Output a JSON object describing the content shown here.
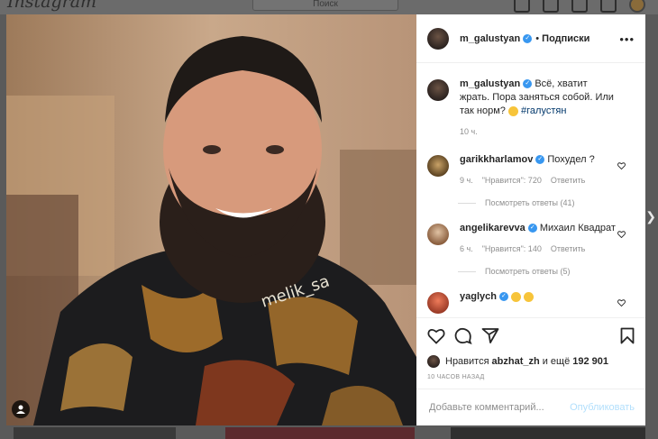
{
  "app": {
    "logo": "Instagram",
    "search_placeholder": "Поиск"
  },
  "post": {
    "author": "m_galustyan",
    "follow_separator": "•",
    "follow_label": "Подписки",
    "more_label": "•••",
    "photo_overlay_text": "melik_sa",
    "caption": {
      "username": "m_galustyan",
      "text": "Всё, хватит жрать. Пора заняться собой. Или так норм?",
      "hashtag": "#галустян",
      "time": "10 ч."
    },
    "comments": [
      {
        "username": "garikkharlamov",
        "text": "Похудел ?",
        "time": "9 ч.",
        "likes": "\"Нравится\": 720",
        "reply": "Ответить",
        "view_replies": "Посмотреть ответы (41)"
      },
      {
        "username": "angelikarevva",
        "text": "Михаил Квадрат",
        "time": "6 ч.",
        "likes": "\"Нравится\": 140",
        "reply": "Ответить",
        "view_replies": "Посмотреть ответы (5)"
      },
      {
        "username": "yaglych",
        "text": ""
      }
    ],
    "likes": {
      "prefix": "Нравится",
      "user": "abzhat_zh",
      "suffix": "и ещё",
      "count": "192 901"
    },
    "timestamp": "10 ЧАСОВ НАЗАД",
    "composer": {
      "placeholder": "Добавьте комментарий...",
      "publish": "Опубликовать"
    }
  },
  "colors": {
    "verified": "#3897f0",
    "link": "#00376b",
    "publish_disabled": "#b2dffc",
    "muted": "#8e8e8e"
  }
}
